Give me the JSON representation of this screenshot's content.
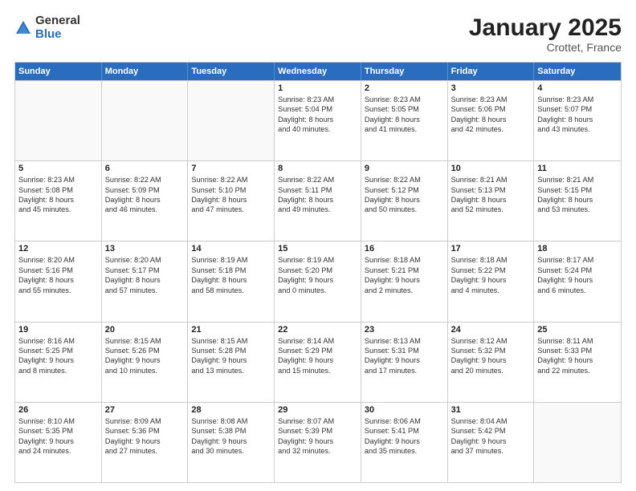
{
  "logo": {
    "general": "General",
    "blue": "Blue"
  },
  "title": "January 2025",
  "subtitle": "Crottet, France",
  "days": [
    "Sunday",
    "Monday",
    "Tuesday",
    "Wednesday",
    "Thursday",
    "Friday",
    "Saturday"
  ],
  "rows": [
    [
      {
        "day": "",
        "lines": []
      },
      {
        "day": "",
        "lines": []
      },
      {
        "day": "",
        "lines": []
      },
      {
        "day": "1",
        "lines": [
          "Sunrise: 8:23 AM",
          "Sunset: 5:04 PM",
          "Daylight: 8 hours",
          "and 40 minutes."
        ]
      },
      {
        "day": "2",
        "lines": [
          "Sunrise: 8:23 AM",
          "Sunset: 5:05 PM",
          "Daylight: 8 hours",
          "and 41 minutes."
        ]
      },
      {
        "day": "3",
        "lines": [
          "Sunrise: 8:23 AM",
          "Sunset: 5:06 PM",
          "Daylight: 8 hours",
          "and 42 minutes."
        ]
      },
      {
        "day": "4",
        "lines": [
          "Sunrise: 8:23 AM",
          "Sunset: 5:07 PM",
          "Daylight: 8 hours",
          "and 43 minutes."
        ]
      }
    ],
    [
      {
        "day": "5",
        "lines": [
          "Sunrise: 8:23 AM",
          "Sunset: 5:08 PM",
          "Daylight: 8 hours",
          "and 45 minutes."
        ]
      },
      {
        "day": "6",
        "lines": [
          "Sunrise: 8:22 AM",
          "Sunset: 5:09 PM",
          "Daylight: 8 hours",
          "and 46 minutes."
        ]
      },
      {
        "day": "7",
        "lines": [
          "Sunrise: 8:22 AM",
          "Sunset: 5:10 PM",
          "Daylight: 8 hours",
          "and 47 minutes."
        ]
      },
      {
        "day": "8",
        "lines": [
          "Sunrise: 8:22 AM",
          "Sunset: 5:11 PM",
          "Daylight: 8 hours",
          "and 49 minutes."
        ]
      },
      {
        "day": "9",
        "lines": [
          "Sunrise: 8:22 AM",
          "Sunset: 5:12 PM",
          "Daylight: 8 hours",
          "and 50 minutes."
        ]
      },
      {
        "day": "10",
        "lines": [
          "Sunrise: 8:21 AM",
          "Sunset: 5:13 PM",
          "Daylight: 8 hours",
          "and 52 minutes."
        ]
      },
      {
        "day": "11",
        "lines": [
          "Sunrise: 8:21 AM",
          "Sunset: 5:15 PM",
          "Daylight: 8 hours",
          "and 53 minutes."
        ]
      }
    ],
    [
      {
        "day": "12",
        "lines": [
          "Sunrise: 8:20 AM",
          "Sunset: 5:16 PM",
          "Daylight: 8 hours",
          "and 55 minutes."
        ]
      },
      {
        "day": "13",
        "lines": [
          "Sunrise: 8:20 AM",
          "Sunset: 5:17 PM",
          "Daylight: 8 hours",
          "and 57 minutes."
        ]
      },
      {
        "day": "14",
        "lines": [
          "Sunrise: 8:19 AM",
          "Sunset: 5:18 PM",
          "Daylight: 8 hours",
          "and 58 minutes."
        ]
      },
      {
        "day": "15",
        "lines": [
          "Sunrise: 8:19 AM",
          "Sunset: 5:20 PM",
          "Daylight: 9 hours",
          "and 0 minutes."
        ]
      },
      {
        "day": "16",
        "lines": [
          "Sunrise: 8:18 AM",
          "Sunset: 5:21 PM",
          "Daylight: 9 hours",
          "and 2 minutes."
        ]
      },
      {
        "day": "17",
        "lines": [
          "Sunrise: 8:18 AM",
          "Sunset: 5:22 PM",
          "Daylight: 9 hours",
          "and 4 minutes."
        ]
      },
      {
        "day": "18",
        "lines": [
          "Sunrise: 8:17 AM",
          "Sunset: 5:24 PM",
          "Daylight: 9 hours",
          "and 6 minutes."
        ]
      }
    ],
    [
      {
        "day": "19",
        "lines": [
          "Sunrise: 8:16 AM",
          "Sunset: 5:25 PM",
          "Daylight: 9 hours",
          "and 8 minutes."
        ]
      },
      {
        "day": "20",
        "lines": [
          "Sunrise: 8:15 AM",
          "Sunset: 5:26 PM",
          "Daylight: 9 hours",
          "and 10 minutes."
        ]
      },
      {
        "day": "21",
        "lines": [
          "Sunrise: 8:15 AM",
          "Sunset: 5:28 PM",
          "Daylight: 9 hours",
          "and 13 minutes."
        ]
      },
      {
        "day": "22",
        "lines": [
          "Sunrise: 8:14 AM",
          "Sunset: 5:29 PM",
          "Daylight: 9 hours",
          "and 15 minutes."
        ]
      },
      {
        "day": "23",
        "lines": [
          "Sunrise: 8:13 AM",
          "Sunset: 5:31 PM",
          "Daylight: 9 hours",
          "and 17 minutes."
        ]
      },
      {
        "day": "24",
        "lines": [
          "Sunrise: 8:12 AM",
          "Sunset: 5:32 PM",
          "Daylight: 9 hours",
          "and 20 minutes."
        ]
      },
      {
        "day": "25",
        "lines": [
          "Sunrise: 8:11 AM",
          "Sunset: 5:33 PM",
          "Daylight: 9 hours",
          "and 22 minutes."
        ]
      }
    ],
    [
      {
        "day": "26",
        "lines": [
          "Sunrise: 8:10 AM",
          "Sunset: 5:35 PM",
          "Daylight: 9 hours",
          "and 24 minutes."
        ]
      },
      {
        "day": "27",
        "lines": [
          "Sunrise: 8:09 AM",
          "Sunset: 5:36 PM",
          "Daylight: 9 hours",
          "and 27 minutes."
        ]
      },
      {
        "day": "28",
        "lines": [
          "Sunrise: 8:08 AM",
          "Sunset: 5:38 PM",
          "Daylight: 9 hours",
          "and 30 minutes."
        ]
      },
      {
        "day": "29",
        "lines": [
          "Sunrise: 8:07 AM",
          "Sunset: 5:39 PM",
          "Daylight: 9 hours",
          "and 32 minutes."
        ]
      },
      {
        "day": "30",
        "lines": [
          "Sunrise: 8:06 AM",
          "Sunset: 5:41 PM",
          "Daylight: 9 hours",
          "and 35 minutes."
        ]
      },
      {
        "day": "31",
        "lines": [
          "Sunrise: 8:04 AM",
          "Sunset: 5:42 PM",
          "Daylight: 9 hours",
          "and 37 minutes."
        ]
      },
      {
        "day": "",
        "lines": []
      }
    ]
  ]
}
